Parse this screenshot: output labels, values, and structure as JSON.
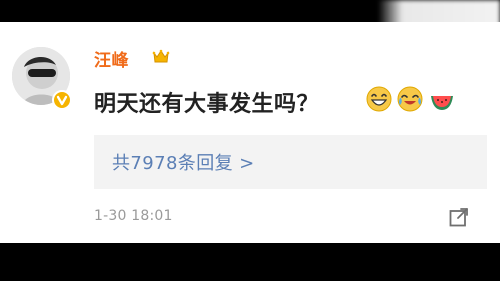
{
  "user": {
    "name": "汪峰",
    "badge_icon": "crown-icon",
    "verified_badge": "verified-v-badge"
  },
  "comment": {
    "text": "明天还有大事发生吗？",
    "emojis": [
      "laughing-emoji",
      "crying-laughing-emoji",
      "watermelon-emoji"
    ]
  },
  "replies": {
    "label": "共7978条回复 >"
  },
  "meta": {
    "timestamp": "1-30 18:01",
    "share_icon": "share-icon"
  },
  "colors": {
    "username": "#f06b1a",
    "link": "#5b7fb5",
    "timestamp": "#9a9a9a",
    "replies_bg": "#f3f3f3"
  }
}
